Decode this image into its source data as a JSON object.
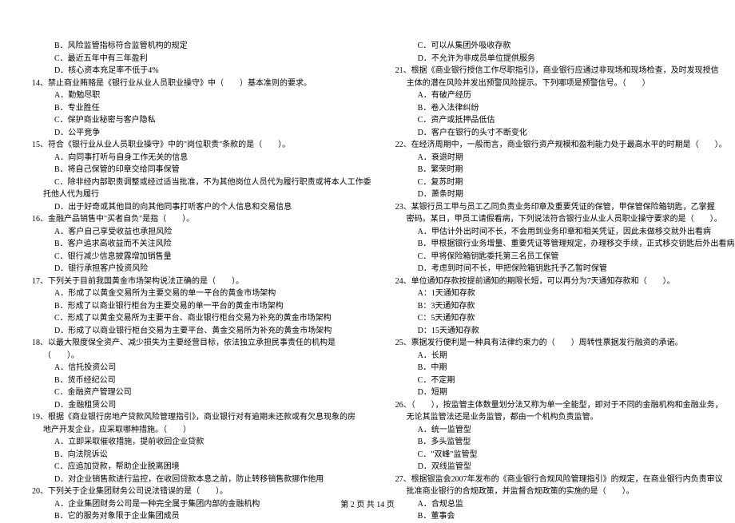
{
  "footer": "第 2 页 共 14 页",
  "left": [
    {
      "cls": "indent-opt",
      "text": "B．风险监管指标符合监管机构的规定"
    },
    {
      "cls": "indent-opt",
      "text": "C．最近五年中有三年盈利"
    },
    {
      "cls": "indent-opt",
      "text": "D．核心资本充足率不低于4%"
    },
    {
      "cls": "indent-q",
      "text": "14、禁止商业贿赂是《银行业从业人员职业操守》中（　　）基本准则的要求。"
    },
    {
      "cls": "indent-opt",
      "text": "A．勤勉尽职"
    },
    {
      "cls": "indent-opt",
      "text": "B．专业胜任"
    },
    {
      "cls": "indent-opt",
      "text": "C．保护商业秘密与客户隐私"
    },
    {
      "cls": "indent-opt",
      "text": "D．公平竞争"
    },
    {
      "cls": "indent-q",
      "text": "15、符合《银行业从业人员职业操守》中的\"岗位职责\"条款的是（　　）。"
    },
    {
      "cls": "indent-opt",
      "text": "A．向同事打听与自身工作无关的信息"
    },
    {
      "cls": "indent-opt",
      "text": "B．将自己保管的印章交给同事保管"
    },
    {
      "cls": "indent-opt",
      "text": "C．除非经内部职责调整或经过适当批准，不为其他岗位人员代为履行职责或将本人工作委"
    },
    {
      "cls": "indent-cont",
      "text": "托他人代为履行"
    },
    {
      "cls": "indent-opt",
      "text": "D．出于好奇或其他目的向其他同事打听客户的个人信息和交易信息"
    },
    {
      "cls": "indent-q",
      "text": "16、金融产品销售中\"买者自负\"是指（　　）。"
    },
    {
      "cls": "indent-opt",
      "text": "A．客户自己享受收益也承担风险"
    },
    {
      "cls": "indent-opt",
      "text": "B．客户追求高收益而不关注风险"
    },
    {
      "cls": "indent-opt",
      "text": "C．银行减少信息披露增加销售量"
    },
    {
      "cls": "indent-opt",
      "text": "D．银行承担客户投资风险"
    },
    {
      "cls": "indent-q",
      "text": "17、下列关于目前我国黄金市场架构说法正确的是（　　）。"
    },
    {
      "cls": "indent-opt",
      "text": "A．形成了以黄金交易所为主要交易的单一平台的黄金市场架构"
    },
    {
      "cls": "indent-opt",
      "text": "B．形成了以商业银行柜台为主要交易的单一平台的黄金市场架构"
    },
    {
      "cls": "indent-opt",
      "text": "C．形成了以黄金交易所为主要平台、商业银行柜台交易为补充的黄金市场架构"
    },
    {
      "cls": "indent-opt",
      "text": "D．形成了以商业银行柜台交易为主要平台、黄金交易所为补充的黄金市场架构"
    },
    {
      "cls": "indent-q",
      "text": "18、以最大限度保全资产、减少损失为主要经营目标，依法独立承担民事责任的机构是"
    },
    {
      "cls": "indent-cont",
      "text": "（　　）。"
    },
    {
      "cls": "indent-opt",
      "text": "A．信托投资公司"
    },
    {
      "cls": "indent-opt",
      "text": "B．货币经纪公司"
    },
    {
      "cls": "indent-opt",
      "text": "C．金融资产管理公司"
    },
    {
      "cls": "indent-opt",
      "text": "D．金融租赁公司"
    },
    {
      "cls": "indent-q",
      "text": "19、根据《商业银行房地产贷款风险管理指引》，商业银行对有逾期未还款或有欠息现象的房"
    },
    {
      "cls": "indent-cont",
      "text": "地产开发企业，应采取哪种措施。（　　）"
    },
    {
      "cls": "indent-opt",
      "text": "A．立即采取催收措施，提前收回企业贷款"
    },
    {
      "cls": "indent-opt",
      "text": "B．向法院诉讼"
    },
    {
      "cls": "indent-opt",
      "text": "C．应追加贷款，帮助企业脱离困境"
    },
    {
      "cls": "indent-opt",
      "text": "D．对企业销售款进行监控，在收回贷款本息之前，防止转移销售款挪作他用"
    },
    {
      "cls": "indent-q",
      "text": "20、下列关于企业集团财务公司说法错误的是（　　）。"
    },
    {
      "cls": "indent-opt",
      "text": "A．企业集团财务公司是一种完全属于集团内部的金融机构"
    },
    {
      "cls": "indent-opt",
      "text": "B．它的服务对象限于企业集团成员"
    }
  ],
  "right": [
    {
      "cls": "indent-opt",
      "text": "C．可以从集团外吸收存款"
    },
    {
      "cls": "indent-opt",
      "text": "D．不允许为非成员单位提供服务"
    },
    {
      "cls": "indent-q",
      "text": "21、根据《商业银行授信工作尽职指引》，商业银行应通过非现场和现场检查，及时发现授信"
    },
    {
      "cls": "indent-cont",
      "text": "主体的潜在风险并发出预警风险提示。下列哪项是预警信号。（　　）"
    },
    {
      "cls": "indent-opt",
      "text": "A．有破产经历"
    },
    {
      "cls": "indent-opt",
      "text": "B．卷入法律纠纷"
    },
    {
      "cls": "indent-opt",
      "text": "C．资产或抵押品低估"
    },
    {
      "cls": "indent-opt",
      "text": "D．客户在银行的头寸不断变化"
    },
    {
      "cls": "indent-q",
      "text": "22、在经济周期中，一般而言，商业银行资产规模和盈利能力处于最高水平的时期是（　　）。"
    },
    {
      "cls": "indent-opt",
      "text": "A．衰退时期"
    },
    {
      "cls": "indent-opt",
      "text": "B．繁荣时期"
    },
    {
      "cls": "indent-opt",
      "text": "C．复苏时期"
    },
    {
      "cls": "indent-opt",
      "text": "D．萧条时期"
    },
    {
      "cls": "indent-q",
      "text": "23、某银行员工甲与员工乙同负责业务印章及重要凭证的保管，甲保管保险箱钥匙，乙掌握"
    },
    {
      "cls": "indent-cont",
      "text": "密码。某日，甲员工请假看病，下列说法符合银行业从业人员职业操守要求的是（　　）。"
    },
    {
      "cls": "indent-opt",
      "text": "A．甲估计外出时间不长，不会用到业务印章和相关凭证，因此未做移交就外出看病"
    },
    {
      "cls": "indent-opt",
      "text": "B．甲根据银行业务增量、重要凭证等管理规定，办理移交手续，正式移交钥匙后外出看病"
    },
    {
      "cls": "indent-opt",
      "text": "C．甲将保险箱钥匙委托第三名员工保管"
    },
    {
      "cls": "indent-opt",
      "text": "D．考虑到时间不长，甲把保险箱钥匙托予乙暂时保管"
    },
    {
      "cls": "indent-q",
      "text": "24、单位通知存款按提前通知的期限长短，可以再分为7天通知存款和（　　）。"
    },
    {
      "cls": "indent-opt",
      "text": "A：1天通知存款"
    },
    {
      "cls": "indent-opt",
      "text": "B：3天通知存款"
    },
    {
      "cls": "indent-opt",
      "text": "C：5天通知存款"
    },
    {
      "cls": "indent-opt",
      "text": "D：15天通知存款"
    },
    {
      "cls": "indent-q",
      "text": "25、票据发行便利是一种具有法律约束力的（　　）周转性票据发行融资的承诺。"
    },
    {
      "cls": "indent-opt",
      "text": "A．长期"
    },
    {
      "cls": "indent-opt",
      "text": "B．中期"
    },
    {
      "cls": "indent-opt",
      "text": "C．不定期"
    },
    {
      "cls": "indent-opt",
      "text": "D．短期"
    },
    {
      "cls": "indent-q",
      "text": "26、（　　），按监管主体数量划分法又称为单一全能型，即对于不同的金融机构和金融业务，"
    },
    {
      "cls": "indent-cont",
      "text": "无论其监管法还是业务监管，都由一个机构负责监管。"
    },
    {
      "cls": "indent-opt",
      "text": "A．统一监管型"
    },
    {
      "cls": "indent-opt",
      "text": "B．多头监管型"
    },
    {
      "cls": "indent-opt",
      "text": "C．\"双峰\"监管型"
    },
    {
      "cls": "indent-opt",
      "text": "D．双线监管型"
    },
    {
      "cls": "indent-q",
      "text": "27、根据银监会2007年发布的《商业银行合规风险管理指引》的规定，在商业银行内负责审议"
    },
    {
      "cls": "indent-cont",
      "text": "批准商业银行的合规政策，并监督合规政策的实施的是（　　）。"
    },
    {
      "cls": "indent-opt",
      "text": "A．合规总监"
    },
    {
      "cls": "indent-opt",
      "text": "B．董事会"
    }
  ]
}
